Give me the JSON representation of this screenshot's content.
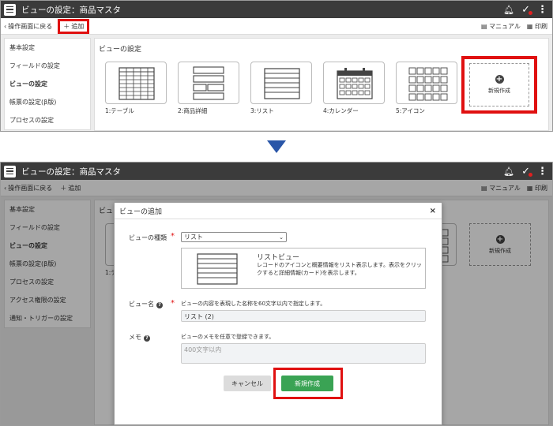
{
  "app": {
    "title": "ビューの設定：商品マスタ",
    "back_label": "操作画面に戻る",
    "add_label": "追加",
    "manual_label": "マニュアル",
    "print_label": "印刷"
  },
  "top_panel": {
    "side_menu": [
      "基本設定",
      "フィールドの設定",
      "ビューの設定",
      "帳票の設定(β版)",
      "プロセスの設定"
    ],
    "active_item": "ビューの設定",
    "main_title": "ビューの設定",
    "views": [
      {
        "label": "1:テーブル",
        "icon": "table-icon"
      },
      {
        "label": "2:商品詳細",
        "icon": "form-icon"
      },
      {
        "label": "3:リスト",
        "icon": "list-icon"
      },
      {
        "label": "4:カレンダー",
        "icon": "calendar-icon"
      },
      {
        "label": "5:アイコン",
        "icon": "icon-grid-icon"
      }
    ],
    "new_tile_label": "新規作成"
  },
  "bottom_panel": {
    "side_menu": [
      "基本設定",
      "フィールドの設定",
      "ビューの設定",
      "帳票の設定(β版)",
      "プロセスの設定",
      "アクセス権限の設定",
      "通知・トリガーの設定"
    ],
    "active_item": "ビューの設定",
    "bg_main_title": "ビュ",
    "bg_tile_label": "1:テ",
    "bg_new_label": "新規作成"
  },
  "dialog": {
    "title": "ビューの追加",
    "view_type_label": "ビューの種類",
    "view_type_value": "リスト",
    "preview_title": "リストビュー",
    "preview_desc": "レコードのアイコンと概要情報をリスト表示します。表示をクリックすると詳細情報(カード)を表示します。",
    "name_label": "ビュー名",
    "name_hint": "ビューの内容を表現した名称を60文字以内で指定します。",
    "name_value": "リスト (2)",
    "memo_label": "メモ",
    "memo_hint": "ビューのメモを任意で登録できます。",
    "memo_placeholder": "400文字以内",
    "cancel_label": "キャンセル",
    "create_label": "新規作成"
  },
  "colors": {
    "titlebar": "#3b3b3b",
    "highlight": "#e01010",
    "create_button": "#3aa354",
    "arrow": "#2a56a8"
  }
}
